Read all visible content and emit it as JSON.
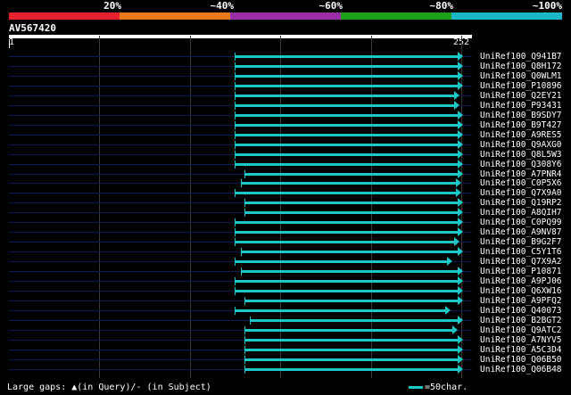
{
  "legend": {
    "labels": [
      "20%",
      "~40%",
      "~60%",
      "~80%",
      "~100%"
    ],
    "colors": [
      "#e8202e",
      "#e87a1c",
      "#9a2ea6",
      "#1ca11c",
      "#1cb8c8"
    ]
  },
  "query": {
    "id": "AV567420",
    "start": "1",
    "end": "252"
  },
  "hit_color": "#1cc7c7",
  "hits": [
    {
      "label": "UniRef100_Q941B7",
      "start": 126,
      "end": 252
    },
    {
      "label": "UniRef100_Q8H172",
      "start": 126,
      "end": 252
    },
    {
      "label": "UniRef100_Q0WLM1",
      "start": 126,
      "end": 252
    },
    {
      "label": "UniRef100_P10896",
      "start": 126,
      "end": 252
    },
    {
      "label": "UniRef100_Q2EY21",
      "start": 126,
      "end": 250
    },
    {
      "label": "UniRef100_P93431",
      "start": 126,
      "end": 250
    },
    {
      "label": "UniRef100_B9SDY7",
      "start": 126,
      "end": 252
    },
    {
      "label": "UniRef100_B9T427",
      "start": 126,
      "end": 252
    },
    {
      "label": "UniRef100_A9RES5",
      "start": 126,
      "end": 252
    },
    {
      "label": "UniRef100_Q9AXG0",
      "start": 126,
      "end": 252
    },
    {
      "label": "UniRef100_Q8L5W3",
      "start": 126,
      "end": 252
    },
    {
      "label": "UniRef100_Q308Y6",
      "start": 126,
      "end": 252
    },
    {
      "label": "UniRef100_A7PNR4",
      "start": 131,
      "end": 252
    },
    {
      "label": "UniRef100_C0P5X6",
      "start": 129,
      "end": 251
    },
    {
      "label": "UniRef100_Q7X9A0",
      "start": 126,
      "end": 251
    },
    {
      "label": "UniRef100_Q19RP2",
      "start": 131,
      "end": 252
    },
    {
      "label": "UniRef100_A8QIH7",
      "start": 131,
      "end": 252
    },
    {
      "label": "UniRef100_C0PQ99",
      "start": 126,
      "end": 252
    },
    {
      "label": "UniRef100_A9NV87",
      "start": 126,
      "end": 252
    },
    {
      "label": "UniRef100_B9G2F7",
      "start": 126,
      "end": 250
    },
    {
      "label": "UniRef100_C5Y1T6",
      "start": 129,
      "end": 252
    },
    {
      "label": "UniRef100_Q7X9A2",
      "start": 126,
      "end": 246
    },
    {
      "label": "UniRef100_P10871",
      "start": 129,
      "end": 252
    },
    {
      "label": "UniRef100_A9PJ06",
      "start": 126,
      "end": 252
    },
    {
      "label": "UniRef100_Q6XW16",
      "start": 126,
      "end": 252
    },
    {
      "label": "UniRef100_A9PFQ2",
      "start": 131,
      "end": 252
    },
    {
      "label": "UniRef100_Q40073",
      "start": 126,
      "end": 245
    },
    {
      "label": "UniRef100_B2BGT2",
      "start": 134,
      "end": 252
    },
    {
      "label": "UniRef100_Q9ATC2",
      "start": 131,
      "end": 249
    },
    {
      "label": "UniRef100_A7NYV5",
      "start": 131,
      "end": 252
    },
    {
      "label": "UniRef100_A5C3D4",
      "start": 131,
      "end": 252
    },
    {
      "label": "UniRef100_Q06B50",
      "start": 131,
      "end": 252
    },
    {
      "label": "UniRef100_Q06B48",
      "start": 131,
      "end": 252
    }
  ],
  "footer": {
    "gaps_text": "Large gaps: ▲(in Query)/- (in Subject)",
    "scale_text": "=50char."
  }
}
